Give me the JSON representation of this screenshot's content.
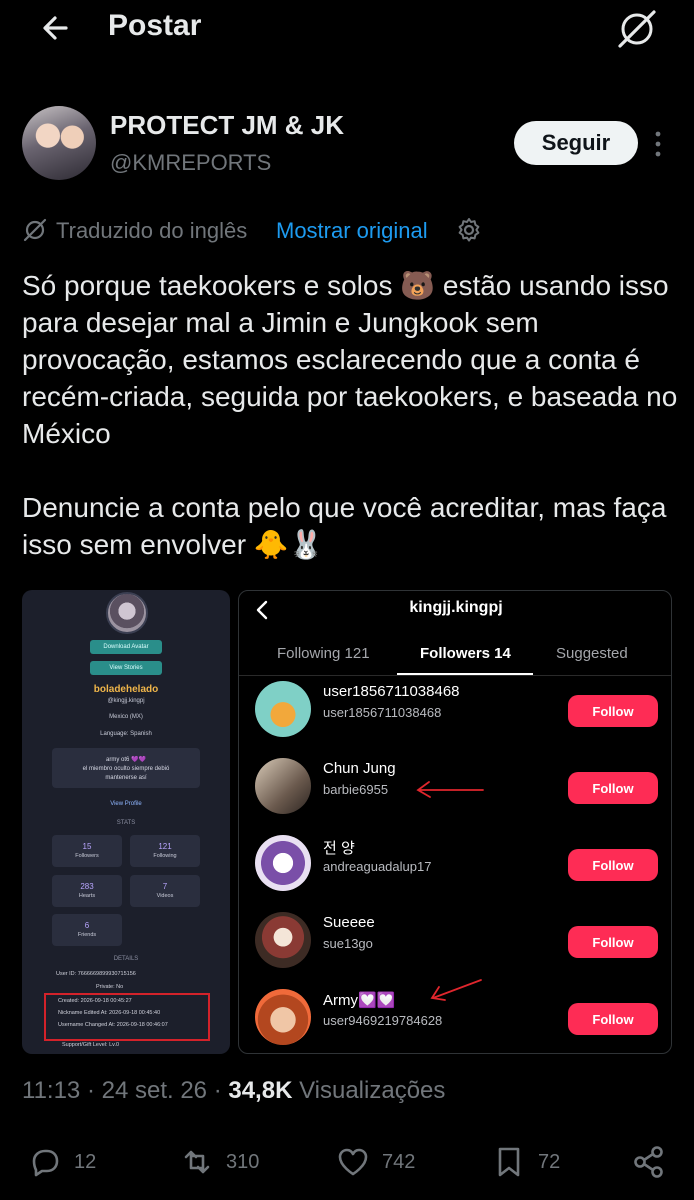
{
  "header": {
    "title": "Postar"
  },
  "author": {
    "name": "PROTECT JM & JK",
    "handle": "@KMREPORTS",
    "follow_label": "Seguir"
  },
  "translation": {
    "label": "Traduzido do inglês",
    "show_original": "Mostrar original"
  },
  "tweet": {
    "paragraph1": "Só porque taekookers e solos 🐻 estão usando isso para desejar mal a Jimin e Jungkook sem provocação, estamos esclarecendo que a conta é recém-criada, seguida por taekookers, e baseada no México",
    "paragraph2": "Denuncie a conta pelo que você acreditar, mas faça isso sem envolver 🐥🐰"
  },
  "left_shot": {
    "download_avatar": "Download Avatar",
    "view_stories": "View Stories",
    "name": "boladehelado",
    "handle": "@kingjj.kingpj",
    "location": "Mexico (MX)",
    "language": "Language: Spanish",
    "bio_line1": "army ot6 💜💜",
    "bio_line2": "el miembro oculto siempre debió",
    "bio_line3": "mantenerse así",
    "view_profile": "View Profile",
    "stats_title": "STATS",
    "stats": [
      {
        "n": "15",
        "l": "Followers"
      },
      {
        "n": "121",
        "l": "Following"
      },
      {
        "n": "283",
        "l": "Hearts"
      },
      {
        "n": "7",
        "l": "Videos"
      },
      {
        "n": "6",
        "l": "Friends"
      }
    ],
    "details_title": "DETAILS",
    "user_id": "User ID:   7666669899930715156",
    "private": "Private:   No",
    "created": "Created:   2026-09-18 00:45:27",
    "nickname_edited": "Nickname Edited At:   2026-09-18 00:45:40",
    "username_changed": "Username Changed At:   2026-09-18 00:46:07",
    "support_level": "Support/Gift Level:   Lv.0"
  },
  "right_shot": {
    "title": "kingjj.kingpj",
    "tabs": [
      "Following 121",
      "Followers 14",
      "Suggested"
    ],
    "follow_label": "Follow",
    "rows": [
      {
        "name": "user1856711038468",
        "user": "user1856711038468"
      },
      {
        "name": "Chun Jung",
        "user": "barbie6955"
      },
      {
        "name": "전 양",
        "user": "andreaguadalup17"
      },
      {
        "name": "Sueeee",
        "user": "sue13go"
      },
      {
        "name": "Army💟💟",
        "user": "user9469219784628"
      }
    ]
  },
  "meta": {
    "time": "11:13",
    "date": "24 set. 26",
    "views_count": "34,8K",
    "views_label": "Visualizações"
  },
  "metrics": {
    "replies": "12",
    "reposts": "310",
    "likes": "742",
    "bookmarks": "72"
  }
}
